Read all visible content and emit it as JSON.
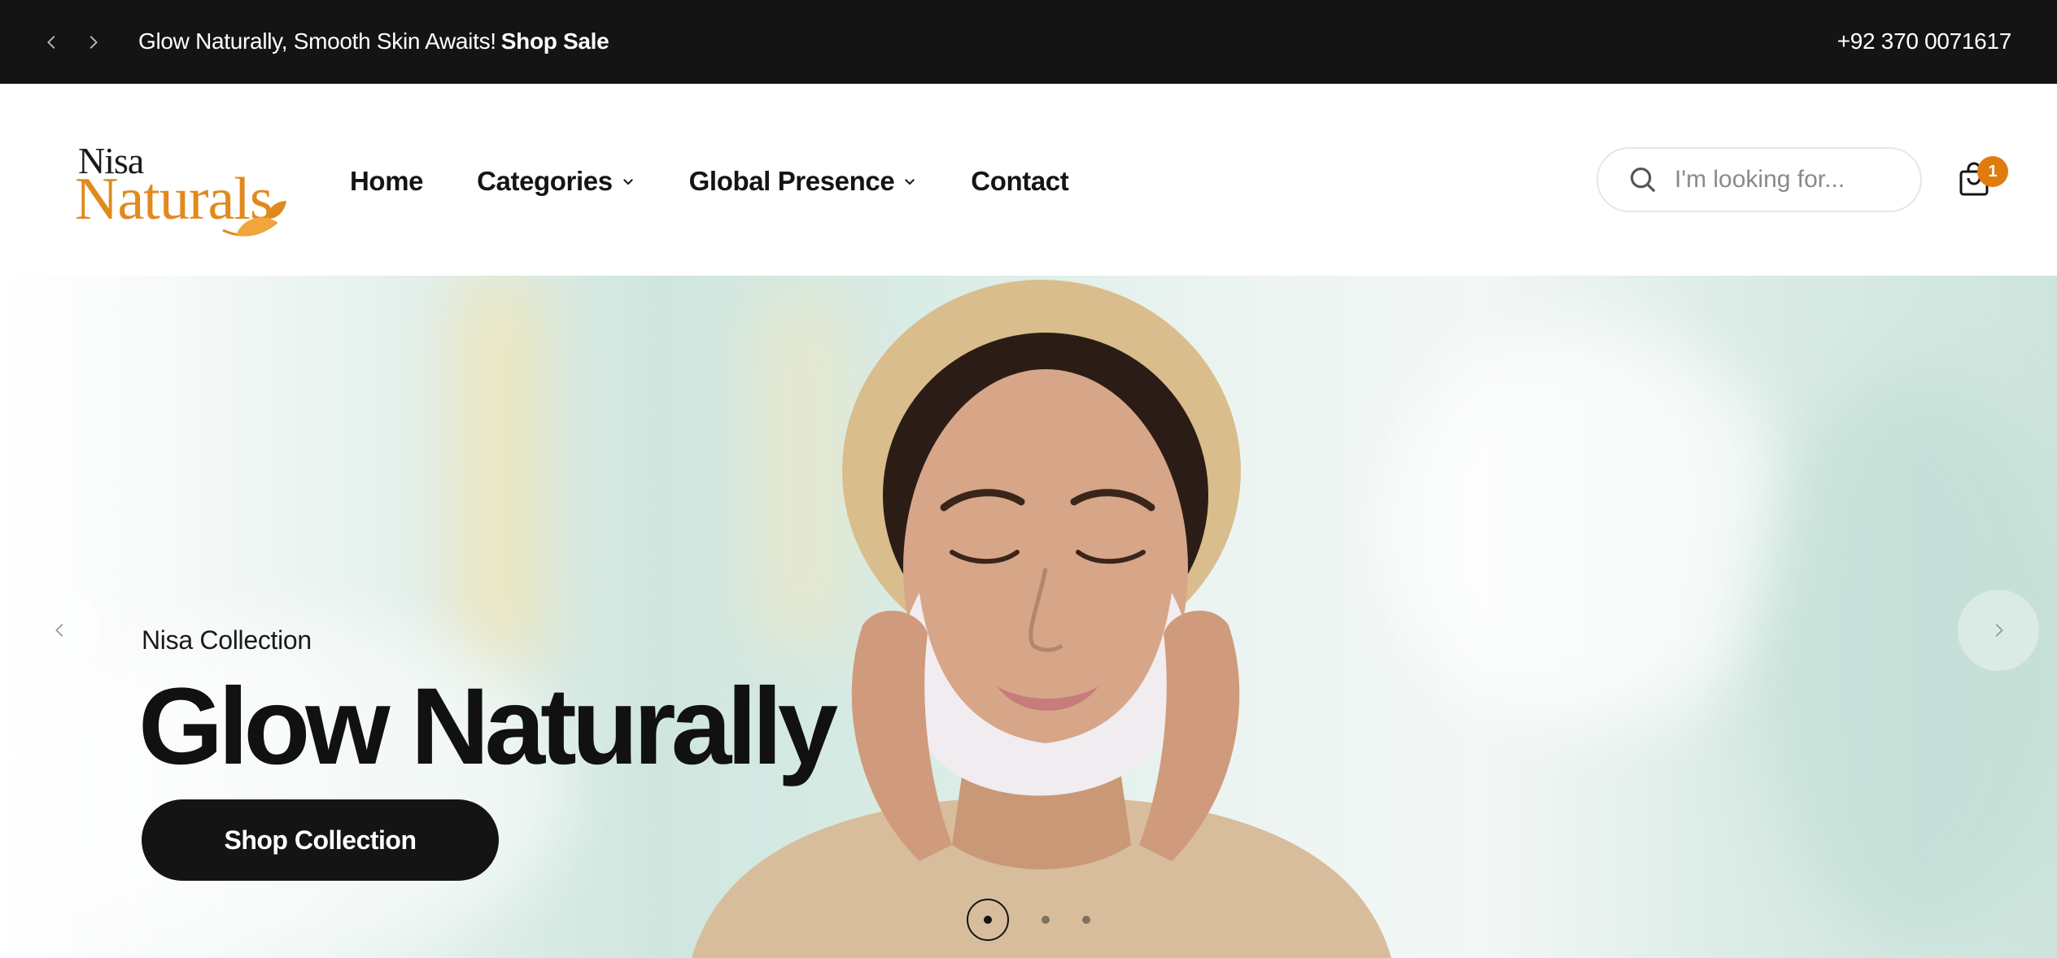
{
  "announcement": {
    "message": "Glow Naturally, Smooth Skin Awaits!",
    "link_label": "Shop Sale",
    "phone": "+92 370 0071617"
  },
  "header": {
    "logo": {
      "line1": "Nisa",
      "line2": "Naturals"
    },
    "nav": [
      {
        "label": "Home",
        "has_dropdown": false
      },
      {
        "label": "Categories",
        "has_dropdown": true
      },
      {
        "label": "Global Presence",
        "has_dropdown": true
      },
      {
        "label": "Contact",
        "has_dropdown": false
      }
    ],
    "search": {
      "placeholder": "I'm looking for...",
      "value": ""
    },
    "cart": {
      "count": "1"
    }
  },
  "hero": {
    "subtitle": "Nisa Collection",
    "title": "Glow Naturally",
    "button_label": "Shop Collection",
    "slides": {
      "total": 3,
      "active": 1
    }
  },
  "icons": {
    "announcement_prev": "chevron-left-icon",
    "announcement_next": "chevron-right-icon",
    "nav_dropdown": "chevron-down-icon",
    "search": "search-icon",
    "cart": "shopping-bag-icon",
    "slide_prev": "chevron-left-icon",
    "slide_next": "chevron-right-icon"
  },
  "colors": {
    "topbar_bg": "#141414",
    "brand_orange": "#e08a1e",
    "badge": "#e07c0e",
    "button_bg": "#141414",
    "text_dark": "#111111"
  }
}
